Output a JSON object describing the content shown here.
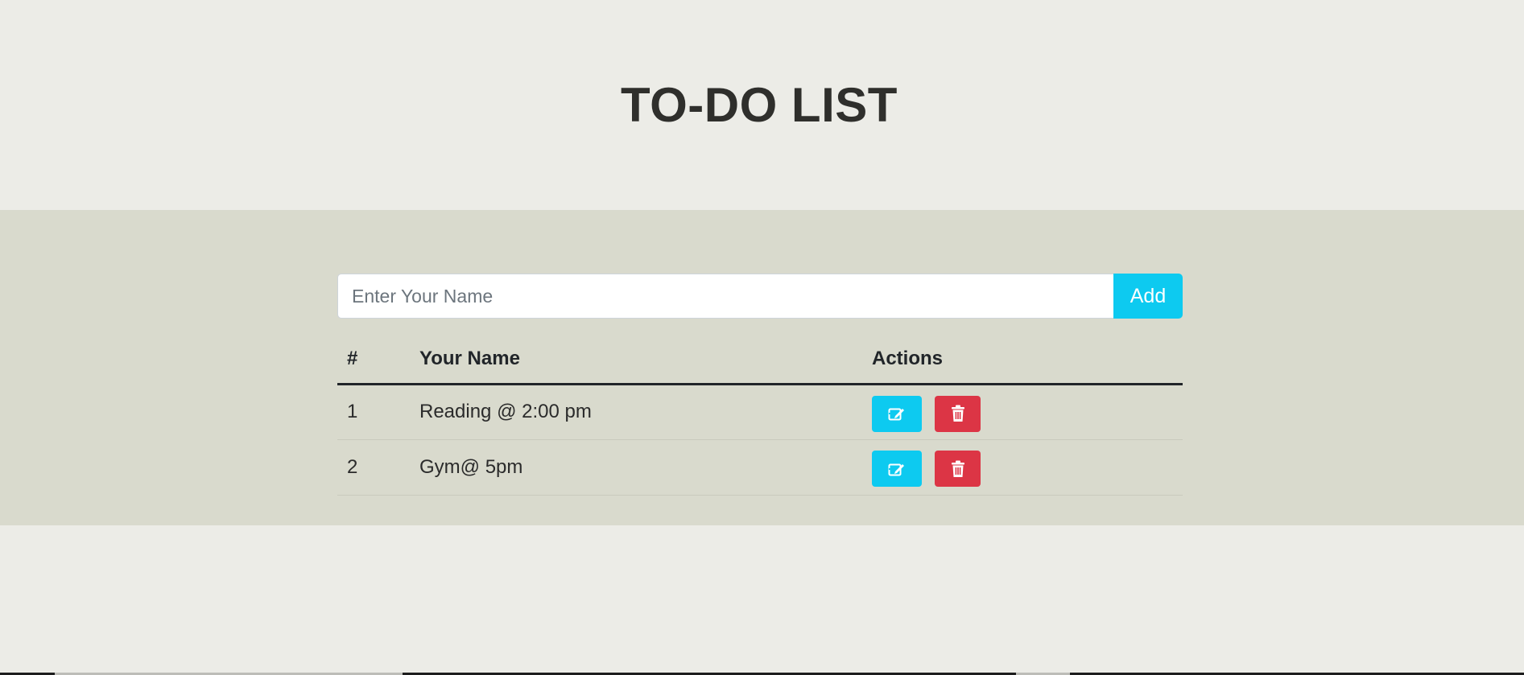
{
  "header": {
    "title": "TO-DO LIST"
  },
  "form": {
    "input_placeholder": "Enter Your Name",
    "input_value": "",
    "add_label": "Add"
  },
  "table": {
    "headers": {
      "num": "#",
      "name": "Your Name",
      "actions": "Actions"
    },
    "rows": [
      {
        "num": "1",
        "name": "Reading @ 2:00 pm"
      },
      {
        "num": "2",
        "name": "Gym@ 5pm"
      }
    ]
  },
  "icons": {
    "edit": "edit-icon",
    "delete": "trash-icon"
  },
  "colors": {
    "accent_info": "#0dcaf0",
    "danger": "#dc3545",
    "band_background": "#d9dacd",
    "page_background": "#ecece7"
  }
}
